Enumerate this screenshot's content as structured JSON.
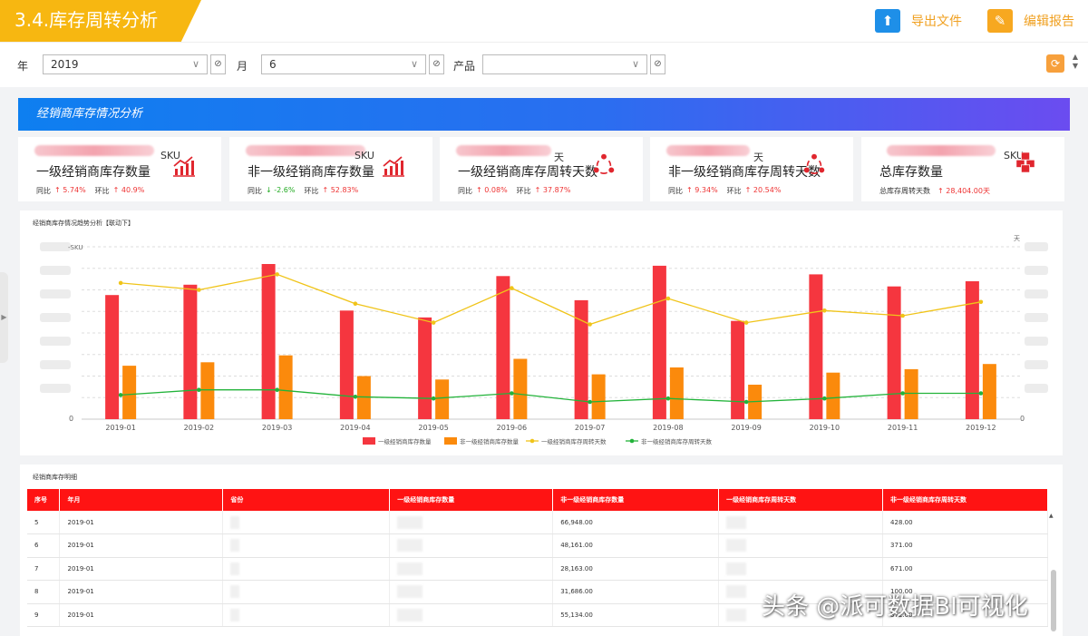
{
  "header": {
    "title": "3.4.库存周转分析",
    "export_label": "导出文件",
    "edit_label": "编辑报告",
    "colors": {
      "accent": "#f7b711",
      "export": "#1e8fe8",
      "edit": "#f7a820"
    }
  },
  "filters": {
    "year_label": "年",
    "year_value": "2019",
    "month_label": "月",
    "month_value": "6",
    "product_label": "产品",
    "product_value": ""
  },
  "section": {
    "title": "经销商库存情况分析"
  },
  "kpis": [
    {
      "unit": "SKU",
      "title": "一级经销商库存数量",
      "m1_label": "同比",
      "m1_dir": "up",
      "m1_value": "5.74%",
      "m2_label": "环比",
      "m2_dir": "up",
      "m2_value": "40.9%",
      "icon": "bar-chart-up-icon"
    },
    {
      "unit": "SKU",
      "title": "非一级经销商库存数量",
      "m1_label": "同比",
      "m1_dir": "down",
      "m1_value": "-2.6%",
      "m2_label": "环比",
      "m2_dir": "up",
      "m2_value": "52.83%",
      "icon": "bar-chart-up-icon"
    },
    {
      "unit": "天",
      "title": "一级经销商库存周转天数",
      "m1_label": "同比",
      "m1_dir": "up",
      "m1_value": "0.08%",
      "m2_label": "环比",
      "m2_dir": "up",
      "m2_value": "37.87%",
      "icon": "cycle-icon"
    },
    {
      "unit": "天",
      "title": "非一级经销商库存周转天数",
      "m1_label": "同比",
      "m1_dir": "up",
      "m1_value": "9.34%",
      "m2_label": "环比",
      "m2_dir": "up",
      "m2_value": "20.54%",
      "icon": "cycle-icon"
    },
    {
      "unit": "SKU",
      "title": "总库存数量",
      "m1_label": "总库存周转天数",
      "m1_dir": "up",
      "m1_value": "28,404.00天",
      "m2_label": "",
      "m2_dir": "",
      "m2_value": "",
      "icon": "cubes-icon"
    }
  ],
  "chart_data": {
    "type": "bar",
    "title": "经销商库存情况趋势分析【联动下】",
    "y_left_unit": "SKU",
    "y_right_unit": "天",
    "y_left_zero": "0",
    "y_right_zero": "0",
    "categories": [
      "2019-01",
      "2019-02",
      "2019-03",
      "2019-04",
      "2019-05",
      "2019-06",
      "2019-07",
      "2019-08",
      "2019-09",
      "2019-10",
      "2019-11",
      "2019-12"
    ],
    "series": [
      {
        "name": "一级经销商库存数量",
        "kind": "bar",
        "axis": "left",
        "color": "#f5363f",
        "values": [
          72,
          78,
          90,
          63,
          59,
          83,
          69,
          89,
          57,
          84,
          77,
          80
        ]
      },
      {
        "name": "非一级经销商库存数量",
        "kind": "bar",
        "axis": "left",
        "color": "#fb8a0c",
        "values": [
          31,
          33,
          37,
          25,
          23,
          35,
          26,
          30,
          20,
          27,
          29,
          32
        ]
      },
      {
        "name": "一级经销商库存周转天数",
        "kind": "line",
        "axis": "right",
        "color": "#f0c419",
        "values": [
          79,
          75,
          84,
          67,
          56,
          76,
          55,
          70,
          56,
          63,
          60,
          68
        ]
      },
      {
        "name": "非一级经销商库存周转天数",
        "kind": "line",
        "axis": "right",
        "color": "#22b33a",
        "values": [
          14,
          17,
          17,
          13,
          12,
          15,
          10,
          12,
          10,
          12,
          15,
          15
        ]
      }
    ],
    "ylim": [
      0,
      100
    ],
    "grid": true,
    "legend_position": "bottom"
  },
  "table": {
    "title": "经销商库存明细",
    "columns": [
      "序号",
      "年月",
      "省份",
      "一级经销商库存数量",
      "非一级经销商库存数量",
      "一级经销商库存周转天数",
      "非一级经销商库存周转天数"
    ],
    "rows": [
      [
        "5",
        "2019-01",
        "",
        "",
        "66,948.00",
        "",
        "428.00"
      ],
      [
        "6",
        "2019-01",
        "",
        "",
        "48,161.00",
        "",
        "371.00"
      ],
      [
        "7",
        "2019-01",
        "",
        "",
        "28,163.00",
        "",
        "671.00"
      ],
      [
        "8",
        "2019-01",
        "",
        "",
        "31,686.00",
        "",
        "100.00"
      ],
      [
        "9",
        "2019-01",
        "",
        "",
        "55,134.00",
        "",
        "372.00"
      ]
    ]
  },
  "watermark": "头条 @派可数据BI可视化"
}
